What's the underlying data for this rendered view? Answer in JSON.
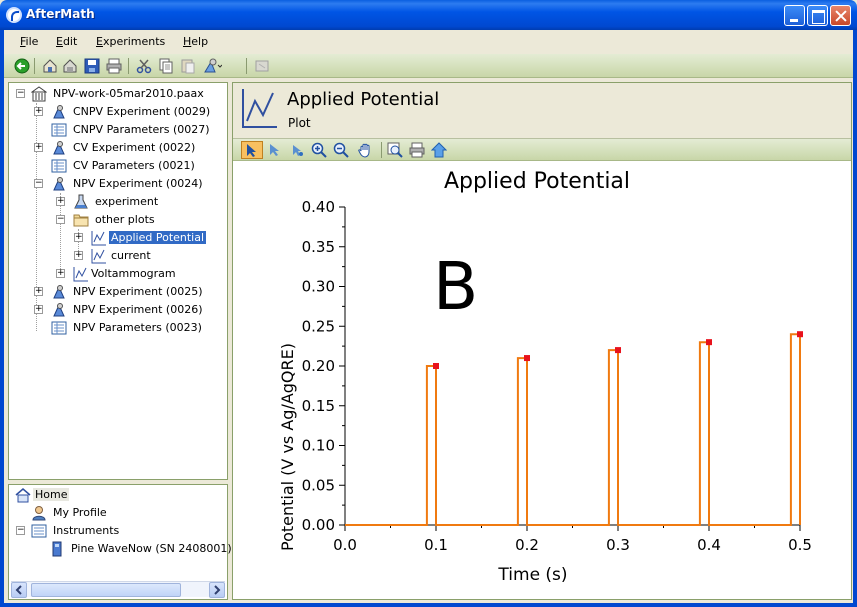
{
  "window": {
    "title": "AfterMath"
  },
  "menu": {
    "file": "File",
    "file_key": "F",
    "file_rest": "ile",
    "edit_key": "E",
    "edit_rest": "dit",
    "experiments_key": "E",
    "experiments_rest": "xperiments",
    "help_key": "H",
    "help_rest": "elp"
  },
  "tree": {
    "root": "NPV-work-05mar2010.paax",
    "items": [
      {
        "label": "CNPV Experiment (0029)"
      },
      {
        "label": "CNPV Parameters (0027)"
      },
      {
        "label": "CV Experiment (0022)"
      },
      {
        "label": "CV Parameters (0021)"
      },
      {
        "label": "NPV Experiment (0024)"
      },
      {
        "label": "experiment"
      },
      {
        "label": "other plots"
      },
      {
        "label": "Applied Potential"
      },
      {
        "label": "current"
      },
      {
        "label": "Voltammogram"
      },
      {
        "label": "NPV Experiment (0025)"
      },
      {
        "label": "NPV Experiment (0026)"
      },
      {
        "label": "NPV Parameters (0023)"
      }
    ]
  },
  "nav": {
    "home": "Home",
    "profile": "My Profile",
    "instruments": "Instruments",
    "device": "Pine WaveNow (SN 2408001)"
  },
  "plot_header": {
    "title": "Applied Potential",
    "subtitle": "Plot"
  },
  "colors": {
    "line": "#f07a10",
    "marker": "#e8121c",
    "selection": "#316ac5"
  },
  "annotation": "B",
  "chart_data": {
    "type": "line",
    "title": "Applied Potential",
    "xlabel": "Time (s)",
    "ylabel": "Potential (V vs Ag/AgQRE)",
    "xlim": [
      0.0,
      0.5
    ],
    "ylim": [
      0.0,
      0.4
    ],
    "xticks": [
      "0.0",
      "0.1",
      "0.2",
      "0.3",
      "0.4",
      "0.5"
    ],
    "yticks": [
      "0.00",
      "0.05",
      "0.10",
      "0.15",
      "0.20",
      "0.25",
      "0.30",
      "0.35",
      "0.40"
    ],
    "grid": false,
    "series": [
      {
        "values": [
          [
            0.0,
            0.0
          ],
          [
            0.09,
            0.0
          ],
          [
            0.09,
            0.2
          ],
          [
            0.1,
            0.2
          ],
          [
            0.1,
            0.0
          ],
          [
            0.19,
            0.0
          ],
          [
            0.19,
            0.21
          ],
          [
            0.2,
            0.21
          ],
          [
            0.2,
            0.0
          ],
          [
            0.29,
            0.0
          ],
          [
            0.29,
            0.22
          ],
          [
            0.3,
            0.22
          ],
          [
            0.3,
            0.0
          ],
          [
            0.39,
            0.0
          ],
          [
            0.39,
            0.23
          ],
          [
            0.4,
            0.23
          ],
          [
            0.4,
            0.0
          ],
          [
            0.49,
            0.0
          ],
          [
            0.49,
            0.24
          ],
          [
            0.5,
            0.24
          ],
          [
            0.5,
            0.0
          ]
        ]
      }
    ],
    "markers": [
      [
        0.1,
        0.2
      ],
      [
        0.2,
        0.21
      ],
      [
        0.3,
        0.22
      ],
      [
        0.4,
        0.23
      ],
      [
        0.5,
        0.24
      ]
    ]
  }
}
